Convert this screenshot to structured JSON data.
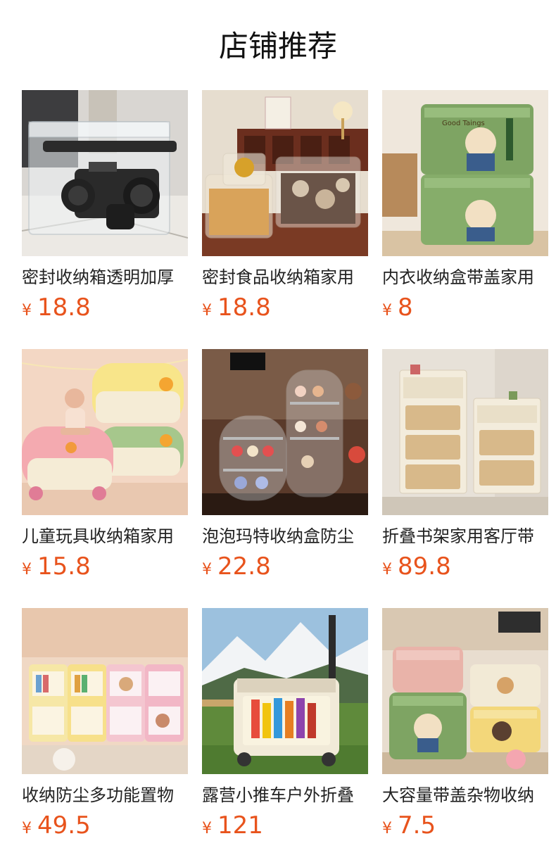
{
  "page": {
    "title": "店铺推荐"
  },
  "products": [
    {
      "name": "密封收纳箱透明加厚",
      "currency": "¥",
      "price": "18.8",
      "image": "clear-sealed-storage-box-with-camera"
    },
    {
      "name": "密封食品收纳箱家用",
      "currency": "¥",
      "price": "18.8",
      "image": "clear-food-containers-with-snacks"
    },
    {
      "name": "内衣收纳盒带盖家用",
      "currency": "¥",
      "price": "8",
      "image": "green-cartoon-dog-storage-box"
    },
    {
      "name": "儿童玩具收纳箱家用",
      "currency": "¥",
      "price": "15.8",
      "image": "duck-shaped-toy-storage-bins-with-child"
    },
    {
      "name": "泡泡玛特收纳盒防尘",
      "currency": "¥",
      "price": "22.8",
      "image": "clear-figure-display-cases"
    },
    {
      "name": "折叠书架家用客厅带",
      "currency": "¥",
      "price": "89.8",
      "image": "folding-bookshelf-cabinets"
    },
    {
      "name": "收纳防尘多功能置物",
      "currency": "¥",
      "price": "49.5",
      "image": "colorful-multifunction-storage-cabinets"
    },
    {
      "name": "露营小推车户外折叠",
      "currency": "¥",
      "price": "121",
      "image": "camping-folding-cart-outdoors"
    },
    {
      "name": "大容量带盖杂物收纳",
      "currency": "¥",
      "price": "7.5",
      "image": "large-cartoon-storage-boxes"
    }
  ],
  "colors": {
    "price": "#e8531c",
    "text": "#222222"
  }
}
